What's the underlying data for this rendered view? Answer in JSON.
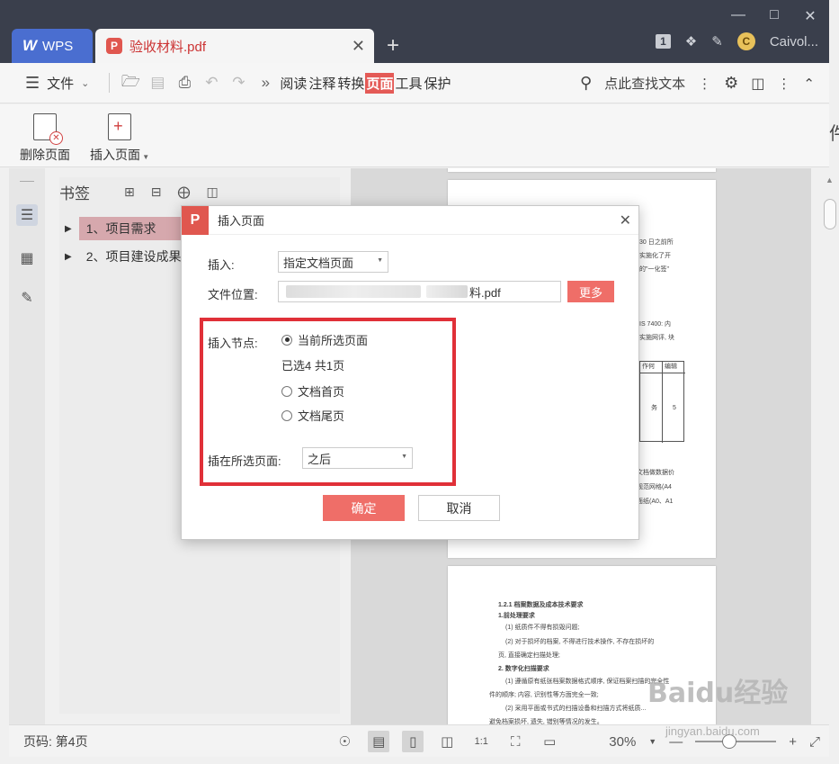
{
  "titlebar": {
    "wps_tab_label": "WPS",
    "doc_tab_label": "验收材料.pdf",
    "tab_count": "1",
    "user_name": "Caivol...",
    "window_controls": [
      "minimize-icon",
      "maximize-icon",
      "close-icon"
    ]
  },
  "menubar": {
    "file_label": "文件",
    "tabs": [
      {
        "label": "阅读",
        "active": false
      },
      {
        "label": "注释",
        "active": false
      },
      {
        "label": "转换",
        "active": false
      },
      {
        "label": "页面",
        "active": true
      },
      {
        "label": "工具",
        "active": false
      },
      {
        "label": "保护",
        "active": false
      }
    ],
    "search_text": "点此查找文本"
  },
  "ribbon": {
    "delete_page_label": "删除页面",
    "insert_page_label": "插入页面"
  },
  "bookmarks": {
    "title": "书签",
    "items": [
      {
        "label": "1、项目需求",
        "selected": true
      },
      {
        "label": "2、项目建设成果",
        "selected": false
      }
    ]
  },
  "dialog": {
    "title": "插入页面",
    "insert_label": "插入:",
    "insert_value": "指定文档页面",
    "file_location_label": "文件位置:",
    "file_value": "料.pdf",
    "more_label": "更多",
    "insert_node_label": "插入节点:",
    "radio_options": [
      {
        "label": "当前所选页面",
        "checked": true
      },
      {
        "label": "文档首页",
        "checked": false
      },
      {
        "label": "文档尾页",
        "checked": false
      }
    ],
    "selected_info": "已选4  共1页",
    "position_label": "插在所选页面:",
    "position_value": "之后",
    "ok_label": "确定",
    "cancel_label": "取消"
  },
  "statusbar": {
    "page_label": "页码: 第4页",
    "zoom_value": "30%"
  },
  "page_snippets": {
    "a_right": [
      "30 日之前所",
      "实施化了开",
      "的\"一化签\"",
      "IS 7400: 内",
      "实施网评, 块",
      "作何",
      "编辑",
      "务",
      "5",
      "文档做数据价",
      "规范网格(A4",
      "面纸(A0、A1"
    ],
    "b_lines": [
      "1.2.1 档案数据及成本技术要求",
      "1.前处理要求",
      "(1) 纸质件不得有损毁问题;",
      "(2) 对于损坏的档案, 不得进行技术操作, 不存在损坏的",
      "页, 直接确定扫描处理;",
      "2. 数字化扫描要求",
      "(1) 遵循原有纸张档案数据格式顺序, 保证档案扫描的完全性",
      "件的顺序; 内容, 识别性等方面完全一致;",
      "(2) 采用平面或书式的扫描设备和扫描方式将纸质...",
      "避免档案损坏, 遗失, 错别等情况的发生。"
    ]
  },
  "watermark": {
    "text": "Baidu经验",
    "sub": "jingyan.baidu.com"
  },
  "side_char": "件"
}
